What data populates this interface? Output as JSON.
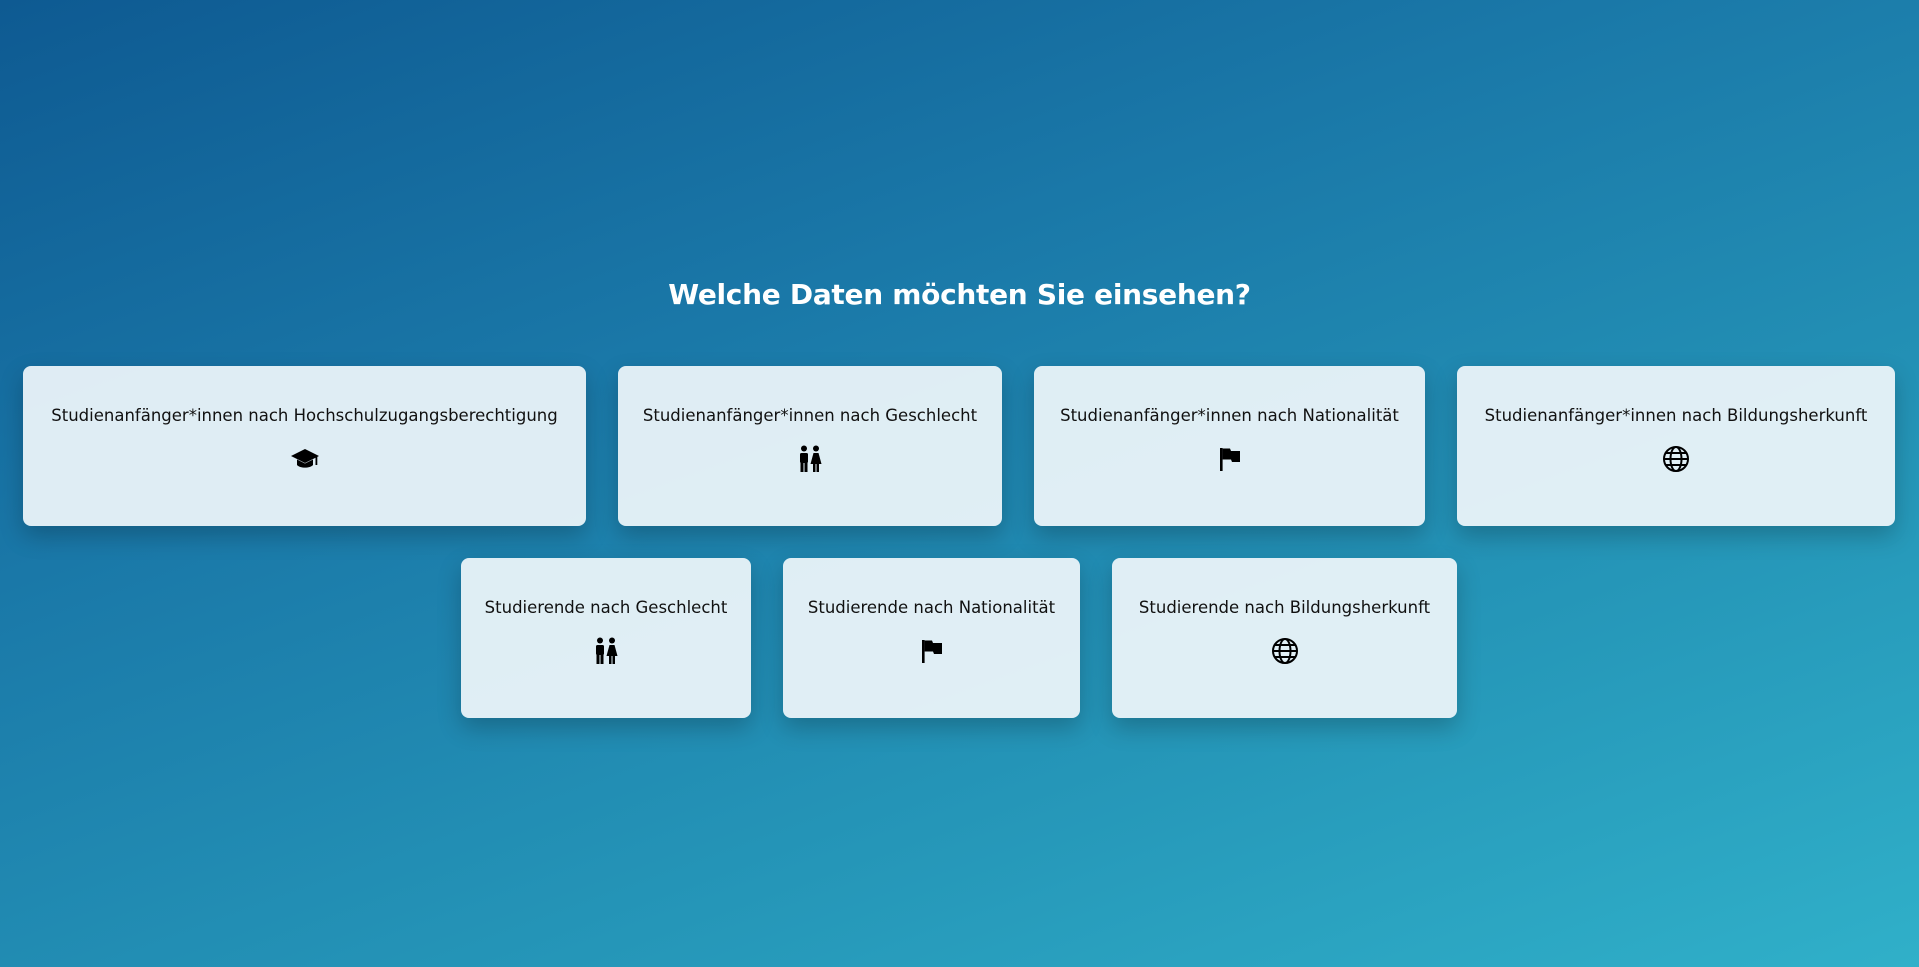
{
  "page": {
    "title": "Welche Daten möchten Sie einsehen?"
  },
  "cards_row_1": [
    {
      "label": "Studienanfänger*innen nach Hochschulzugangsberechtigung",
      "icon": "graduation-cap-icon"
    },
    {
      "label": "Studienanfänger*innen nach Geschlecht",
      "icon": "male-female-icon"
    },
    {
      "label": "Studienanfänger*innen nach Nationalität",
      "icon": "flag-icon"
    },
    {
      "label": "Studienanfänger*innen nach Bildungsherkunft",
      "icon": "globe-icon"
    }
  ],
  "cards_row_2": [
    {
      "label": "Studierende nach Geschlecht",
      "icon": "male-female-icon"
    },
    {
      "label": "Studierende nach Nationalität",
      "icon": "flag-icon"
    },
    {
      "label": "Studierende nach Bildungsherkunft",
      "icon": "globe-icon"
    }
  ],
  "colors": {
    "background_start": "#0e5a92",
    "background_end": "#30b0c9",
    "card_background": "#e6f0f5",
    "title_text": "#ffffff",
    "card_text": "#111111"
  }
}
